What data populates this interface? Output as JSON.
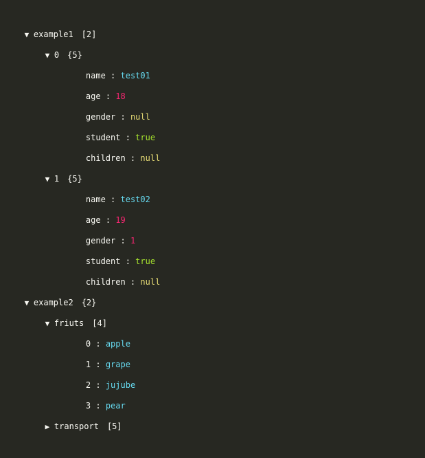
{
  "icons": {
    "expanded": "▼",
    "collapsed": "▶"
  },
  "colors": {
    "background": "#272822",
    "key": "#f8f8f2",
    "string": "#66d9ef",
    "number": "#f92672",
    "null": "#e6db74",
    "boolean": "#a6e22e"
  },
  "tree": {
    "example1": {
      "key": "example1",
      "count": "[2]",
      "items": [
        {
          "key": "0",
          "count": "{5}",
          "fields": [
            {
              "key": "name",
              "value": "test01",
              "type": "string"
            },
            {
              "key": "age",
              "value": "18",
              "type": "number"
            },
            {
              "key": "gender",
              "value": "null",
              "type": "null"
            },
            {
              "key": "student",
              "value": "true",
              "type": "boolean"
            },
            {
              "key": "children",
              "value": "null",
              "type": "null"
            }
          ]
        },
        {
          "key": "1",
          "count": "{5}",
          "fields": [
            {
              "key": "name",
              "value": "test02",
              "type": "string"
            },
            {
              "key": "age",
              "value": "19",
              "type": "number"
            },
            {
              "key": "gender",
              "value": "1",
              "type": "number"
            },
            {
              "key": "student",
              "value": "true",
              "type": "boolean"
            },
            {
              "key": "children",
              "value": "null",
              "type": "null"
            }
          ]
        }
      ]
    },
    "example2": {
      "key": "example2",
      "count": "{2}",
      "friuts": {
        "key": "friuts",
        "count": "[4]",
        "items": [
          {
            "key": "0",
            "value": "apple"
          },
          {
            "key": "1",
            "value": "grape"
          },
          {
            "key": "2",
            "value": "jujube"
          },
          {
            "key": "3",
            "value": "pear"
          }
        ]
      },
      "transport": {
        "key": "transport",
        "count": "[5]"
      }
    },
    "separator": " : "
  }
}
